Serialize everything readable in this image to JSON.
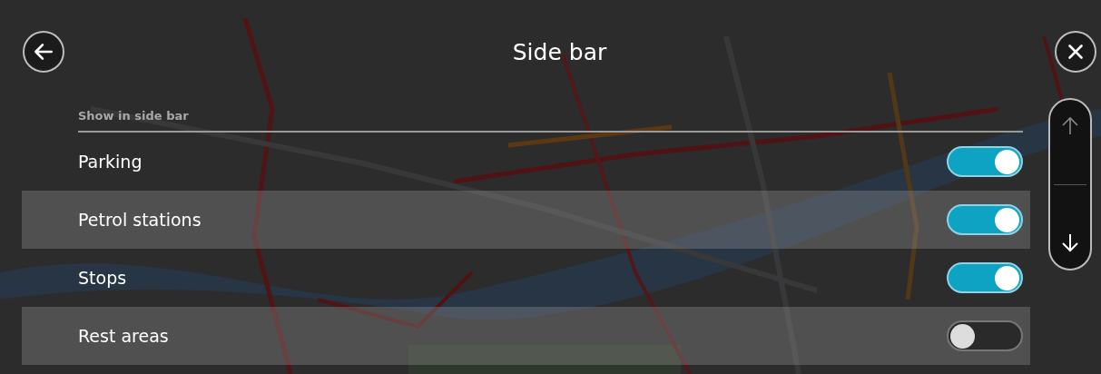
{
  "header": {
    "title": "Side bar"
  },
  "section_heading": "Show in side bar",
  "items": [
    {
      "label": "Parking",
      "on": true
    },
    {
      "label": "Petrol stations",
      "on": true
    },
    {
      "label": "Stops",
      "on": true
    },
    {
      "label": "Rest areas",
      "on": false
    }
  ],
  "scroll": {
    "up_disabled": true,
    "down_disabled": false
  }
}
